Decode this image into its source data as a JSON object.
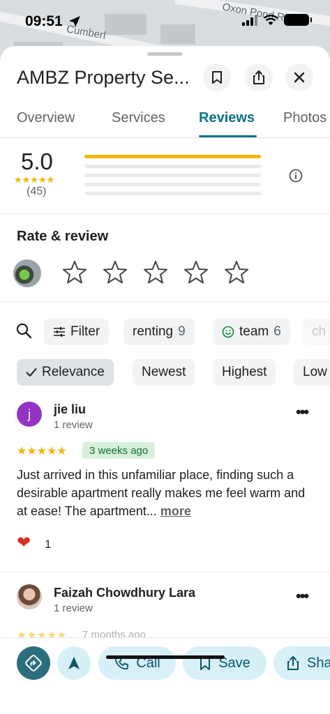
{
  "status_bar": {
    "time": "09:51"
  },
  "map": {
    "street_1": "Cumberl",
    "street_2": "Oxon Pond Rd"
  },
  "header": {
    "title": "AMBZ Property Se..."
  },
  "tabs": [
    {
      "label": "Overview"
    },
    {
      "label": "Services"
    },
    {
      "label": "Reviews"
    },
    {
      "label": "Photos"
    }
  ],
  "rating_summary": {
    "score": "5.0",
    "stars": "★★★★★",
    "count": "(45)",
    "distribution_fraction": [
      1.0,
      0,
      0,
      0,
      0
    ]
  },
  "rate_review": {
    "title": "Rate & review"
  },
  "filters": [
    {
      "label": "Filter"
    },
    {
      "label": "renting",
      "count": "9"
    },
    {
      "label": "team",
      "count": "6"
    },
    {
      "label": "ch"
    }
  ],
  "sort": [
    {
      "label": "Relevance",
      "selected": true
    },
    {
      "label": "Newest"
    },
    {
      "label": "Highest"
    },
    {
      "label": "Low"
    }
  ],
  "reviews": [
    {
      "initial": "j",
      "name": "jie liu",
      "meta": "1 review",
      "stars": "★★★★★",
      "when": "3 weeks ago",
      "text": "Just arrived in this unfamiliar place, finding such a desirable apartment really makes me feel warm and at ease! The apartment...",
      "more": "more",
      "reaction_count": "1"
    },
    {
      "name": "Faizah Chowdhury Lara",
      "meta": "1 review",
      "stars": "★★★★★",
      "when": "7 months ago"
    }
  ],
  "actions": {
    "call": "Call",
    "save": "Save",
    "share": "Sha"
  },
  "colors": {
    "accent": "#0b7285",
    "star": "#f4b400",
    "chip_bg": "#f1f3f4",
    "action_bg": "#d7f0f7"
  }
}
